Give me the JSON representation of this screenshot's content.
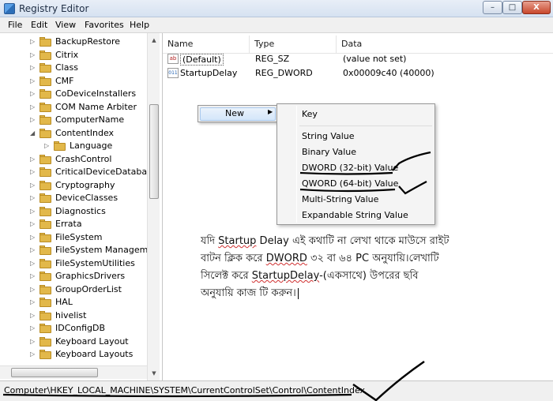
{
  "window": {
    "title": "Registry Editor",
    "min": "–",
    "max": "□",
    "close": "X"
  },
  "menu": [
    "File",
    "Edit",
    "View",
    "Favorites",
    "Help"
  ],
  "tree": [
    {
      "label": "BackupRestore",
      "expanded": false
    },
    {
      "label": "Citrix",
      "expanded": false
    },
    {
      "label": "Class",
      "expanded": false
    },
    {
      "label": "CMF",
      "expanded": false
    },
    {
      "label": "CoDeviceInstallers",
      "expanded": false
    },
    {
      "label": "COM Name Arbiter",
      "expanded": false
    },
    {
      "label": "ComputerName",
      "expanded": false
    },
    {
      "label": "ContentIndex",
      "expanded": true
    },
    {
      "label": "Language",
      "expanded": false,
      "child": true
    },
    {
      "label": "CrashControl",
      "expanded": false
    },
    {
      "label": "CriticalDeviceDatabase",
      "expanded": false
    },
    {
      "label": "Cryptography",
      "expanded": false
    },
    {
      "label": "DeviceClasses",
      "expanded": false
    },
    {
      "label": "Diagnostics",
      "expanded": false
    },
    {
      "label": "Errata",
      "expanded": false
    },
    {
      "label": "FileSystem",
      "expanded": false
    },
    {
      "label": "FileSystem Managemen",
      "expanded": false
    },
    {
      "label": "FileSystemUtilities",
      "expanded": false
    },
    {
      "label": "GraphicsDrivers",
      "expanded": false
    },
    {
      "label": "GroupOrderList",
      "expanded": false
    },
    {
      "label": "HAL",
      "expanded": false
    },
    {
      "label": "hivelist",
      "expanded": false
    },
    {
      "label": "IDConfigDB",
      "expanded": false
    },
    {
      "label": "Keyboard Layout",
      "expanded": false
    },
    {
      "label": "Keyboard Layouts",
      "expanded": false
    }
  ],
  "columns": {
    "name": "Name",
    "type": "Type",
    "data": "Data"
  },
  "values": [
    {
      "name": "(Default)",
      "type": "REG_SZ",
      "data": "(value not set)",
      "icon": "ab"
    },
    {
      "name": "StartupDelay",
      "type": "REG_DWORD",
      "data": "0x00009c40 (40000)",
      "icon": "011"
    }
  ],
  "context_menu": {
    "new_label": "New",
    "arrow": "▶"
  },
  "submenu": [
    "Key",
    "String Value",
    "Binary Value",
    "DWORD (32-bit) Value",
    "QWORD (64-bit) Value",
    "Multi-String Value",
    "Expandable String Value"
  ],
  "note": {
    "line1_a": "যদি ",
    "line1_b": "Startup",
    "line1_c": " Delay এই কথাটি না লেখা থাকে মাউসে রাইট",
    "line2_a": "বাটন ক্লিক করে ",
    "line2_b": "DWORD",
    "line2_c": " ৩২ বা ৬৪ PC অনুযায়ি।লেখাটি",
    "line3_a": "সিলেক্ট করে ",
    "line3_b": "StartupDelay",
    "line3_c": "-(একসাথে) উপরের ছবি",
    "line4": "অনুযায়ি কাজ টি করুন।"
  },
  "status": "Computer\\HKEY_LOCAL_MACHINE\\SYSTEM\\CurrentControlSet\\Control\\ContentIndex"
}
